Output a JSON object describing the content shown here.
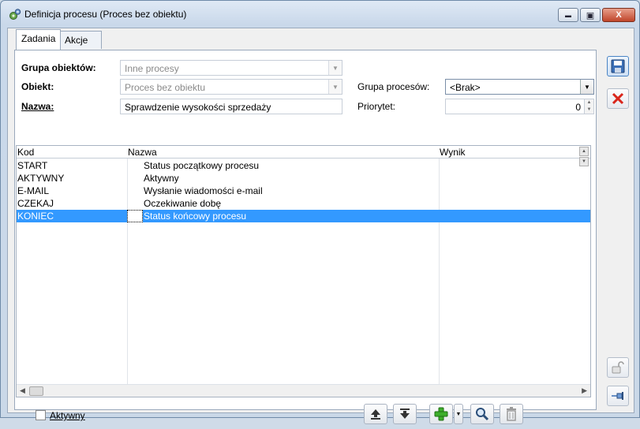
{
  "window": {
    "title": "Definicja procesu (Proces bez obiektu)",
    "minimize_glyph": "▬",
    "maximize_glyph": "▣",
    "close_glyph": "X"
  },
  "tabs": [
    {
      "label": "Zadania",
      "active": true
    },
    {
      "label": "Akcje",
      "active": false
    }
  ],
  "form": {
    "grupa_obiektow_label": "Grupa obiektów:",
    "grupa_obiektow_value": "Inne procesy",
    "obiekt_label": "Obiekt:",
    "obiekt_value": "Proces bez obiektu",
    "nazwa_label": "Nazwa:",
    "nazwa_value": "Sprawdzenie wysokości sprzedaży",
    "grupa_procesow_label": "Grupa procesów:",
    "grupa_procesow_value": "<Brak>",
    "priorytet_label": "Priorytet:",
    "priorytet_value": "0"
  },
  "table": {
    "columns": [
      "Kod",
      "Nazwa",
      "Wynik"
    ],
    "rows": [
      {
        "kod": "START",
        "nazwa": "Status początkowy procesu",
        "wynik": ""
      },
      {
        "kod": "AKTYWNY",
        "nazwa": "Aktywny",
        "wynik": ""
      },
      {
        "kod": "E-MAIL",
        "nazwa": "Wysłanie wiadomości e-mail",
        "wynik": ""
      },
      {
        "kod": "CZEKAJ",
        "nazwa": "Oczekiwanie dobę",
        "wynik": ""
      },
      {
        "kod": "KONIEC",
        "nazwa": "Status końcowy procesu",
        "wynik": "",
        "selected": true
      }
    ]
  },
  "bottom": {
    "aktywny_label": "Aktywny",
    "aktywny_checked": false
  },
  "colors": {
    "selection": "#3399ff",
    "add_green": "#3dae2b",
    "delete_red": "#d9261c",
    "save_blue": "#3b6fb6"
  },
  "icons": {
    "move_up": "move-up-icon",
    "move_down": "move-down-icon",
    "add": "add-icon",
    "search": "search-icon",
    "delete": "trash-icon",
    "save": "save-icon",
    "cancel": "cancel-icon",
    "lock": "unlock-icon",
    "pin": "pin-icon"
  }
}
